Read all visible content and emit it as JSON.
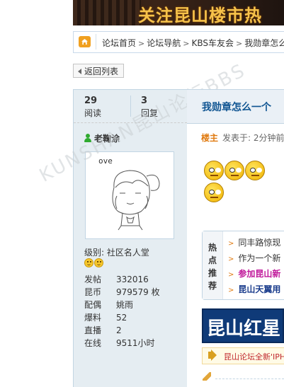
{
  "banner": {
    "text": "关注昆山楼市热"
  },
  "breadcrumb": {
    "items": [
      "论坛首页",
      "论坛导航",
      "KBS车友会",
      "我勋章怎么"
    ]
  },
  "back_button": {
    "label": "返回列表"
  },
  "stats": {
    "read_count": "29",
    "read_label": "阅读",
    "reply_count": "3",
    "reply_label": "回复"
  },
  "user": {
    "name": "老鞠涂",
    "avatar_caption": "ove",
    "level_text": "级别: 社区名人堂",
    "info": [
      {
        "key": "发帖",
        "value": "332016"
      },
      {
        "key": "昆币",
        "value": "979579 枚"
      },
      {
        "key": "配偶",
        "value": "姚雨"
      },
      {
        "key": "爆料",
        "value": "52"
      },
      {
        "key": "直播",
        "value": "2"
      },
      {
        "key": "在线",
        "value": "9511小时"
      }
    ]
  },
  "watermark": "KUNSHAN昆山论坛BBS",
  "post": {
    "title": "我勋章怎么一个",
    "author_tag": "楼主",
    "posted_text": "发表于: 2分钟前"
  },
  "hot": {
    "label": [
      "热",
      "点",
      "推",
      "荐"
    ],
    "items": [
      {
        "text": "同丰路惊现",
        "color": "#333333",
        "bold": false
      },
      {
        "text": "作为一个新",
        "color": "#333333",
        "bold": false
      },
      {
        "text": "参加昆山新",
        "color": "#c0179a",
        "bold": true
      },
      {
        "text": "昆山天翼用",
        "color": "#1a3c8c",
        "bold": true
      }
    ]
  },
  "ad": {
    "text": "昆山红星"
  },
  "notice": {
    "text": "昆山论坛全新'IPH"
  },
  "colors": {
    "title": "#105592",
    "accent": "#e07a10",
    "sidebar_bg": "#e5edf2",
    "border": "#c2d5e3"
  }
}
